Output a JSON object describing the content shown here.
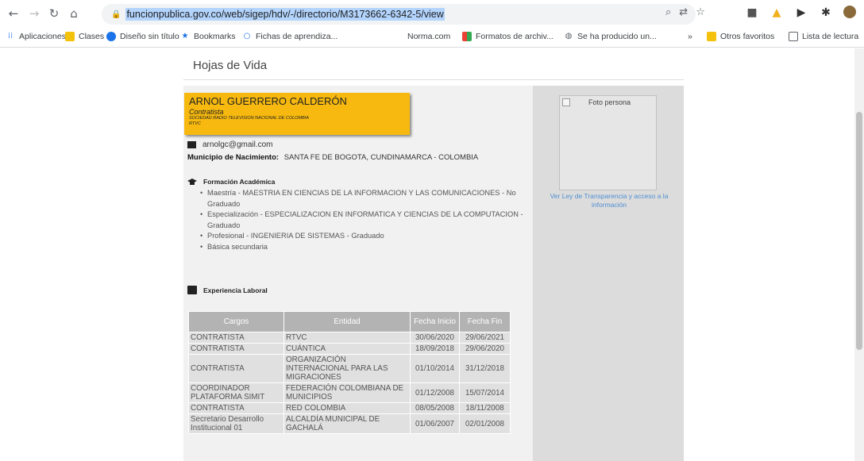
{
  "browser": {
    "url": "funcionpublica.gov.co/web/sigep/hdv/-/directorio/M3173662-6342-5/view",
    "bookmarks": [
      {
        "label": "Aplicaciones"
      },
      {
        "label": "Clases"
      },
      {
        "label": "Diseño sin título"
      },
      {
        "label": "Bookmarks"
      },
      {
        "label": "Fichas de aprendiza..."
      },
      {
        "label": "Norma.com"
      },
      {
        "label": "Formatos de archiv..."
      },
      {
        "label": "Se ha producido un..."
      }
    ],
    "more_bookmarks": "»",
    "other_favorites": "Otros favoritos",
    "reading_list": "Lista de lectura"
  },
  "page": {
    "title": "Hojas de Vida",
    "person": {
      "name": "ARNOL GUERRERO CALDERÓN",
      "role": "Contratista",
      "organization": "SOCIEDAD RADIO TELEVISION NACIONAL DE COLOMBIA",
      "org_code": "RTVC",
      "email": "arnolgc@gmail.com",
      "birthplace_label": "Municipio de Nacimiento:",
      "birthplace": "SANTA FE DE BOGOTA, CUNDINAMARCA - COLOMBIA"
    },
    "education": {
      "title": "Formación Académica",
      "items": [
        "Maestría - MAESTRIA EN CIENCIAS DE LA INFORMACION Y LAS COMUNICACIONES - No Graduado",
        "Especialización - ESPECIALIZACION EN INFORMATICA Y CIENCIAS DE LA COMPUTACION - Graduado",
        "Profesional - INGENIERIA DE SISTEMAS - Graduado",
        "Básica secundaria"
      ]
    },
    "experience": {
      "title": "Experiencia Laboral",
      "headers": [
        "Cargos",
        "Entidad",
        "Fecha Inicio",
        "Fecha Fin"
      ],
      "rows": [
        [
          "CONTRATISTA",
          "RTVC",
          "30/06/2020",
          "29/06/2021"
        ],
        [
          "CONTRATISTA",
          "CUÁNTICA",
          "18/09/2018",
          "29/06/2020"
        ],
        [
          "CONTRATISTA",
          "ORGANIZACIÓN INTERNACIONAL PARA LAS MIGRACIONES",
          "01/10/2014",
          "31/12/2018"
        ],
        [
          "COORDINADOR PLATAFORMA SIMIT",
          "FEDERACIÓN COLOMBIANA DE MUNICIPIOS",
          "01/12/2008",
          "15/07/2014"
        ],
        [
          "CONTRATISTA",
          "RED COLOMBIA",
          "08/05/2008",
          "18/11/2008"
        ],
        [
          "Secretario Desarrollo Institucional 01",
          "ALCALDÍA MUNICIPAL DE GACHALÁ",
          "01/06/2007",
          "02/01/2008"
        ]
      ]
    },
    "photo_alt": "Foto persona",
    "transparency_link": "Ver Ley de Transparencia y acceso a la información"
  }
}
